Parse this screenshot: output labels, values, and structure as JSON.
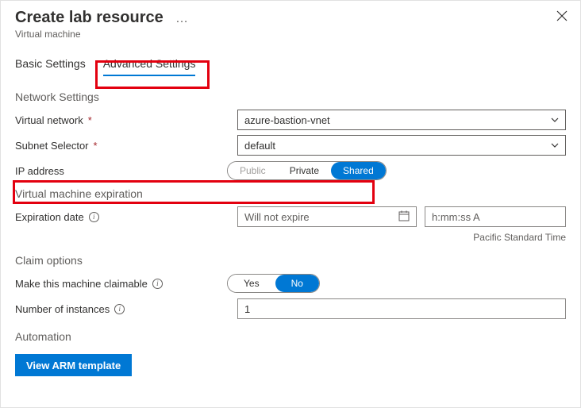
{
  "header": {
    "title": "Create lab resource",
    "subtitle": "Virtual machine",
    "ellipsis": "…"
  },
  "tabs": {
    "basic": "Basic Settings",
    "advanced": "Advanced Settings"
  },
  "network": {
    "title": "Network Settings",
    "vnet_label": "Virtual network",
    "vnet_value": "azure-bastion-vnet",
    "subnet_label": "Subnet Selector",
    "subnet_value": "default",
    "ip_label": "IP address",
    "ip_options": {
      "public": "Public",
      "private": "Private",
      "shared": "Shared"
    }
  },
  "expiration": {
    "title": "Virtual machine expiration",
    "date_label": "Expiration date",
    "date_placeholder": "Will not expire",
    "time_placeholder": "h:mm:ss A",
    "timezone": "Pacific Standard Time"
  },
  "claim": {
    "title": "Claim options",
    "claimable_label": "Make this machine claimable",
    "yes": "Yes",
    "no": "No",
    "instances_label": "Number of instances",
    "instances_value": "1"
  },
  "automation": {
    "title": "Automation",
    "arm_button": "View ARM template"
  }
}
